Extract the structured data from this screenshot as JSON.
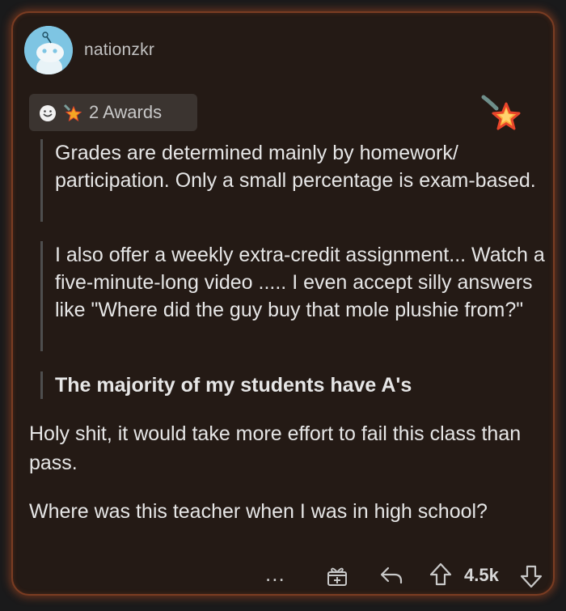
{
  "comment": {
    "username": "nationzkr",
    "awards_label": "2 Awards",
    "quotes": [
      "Grades are determined mainly by homework/ participation. Only a small percentage is exam-based.",
      "I also offer a weekly extra-credit assignment... Watch a five-minute-long video ..... I even accept silly answers like \"Where did the guy buy that mole plushie from?\"",
      "The majority of my students have A's"
    ],
    "paragraphs": [
      "Holy shit, it would take more effort to fail this class than pass.",
      "Where was this teacher when I was in high school?"
    ],
    "actions": {
      "more_label": "...",
      "score": "4.5k"
    }
  },
  "colors": {
    "card_background": "#241a15",
    "card_glow": "#be5023",
    "avatar_background": "#7ec5e3",
    "text": "#e6e6e6"
  }
}
